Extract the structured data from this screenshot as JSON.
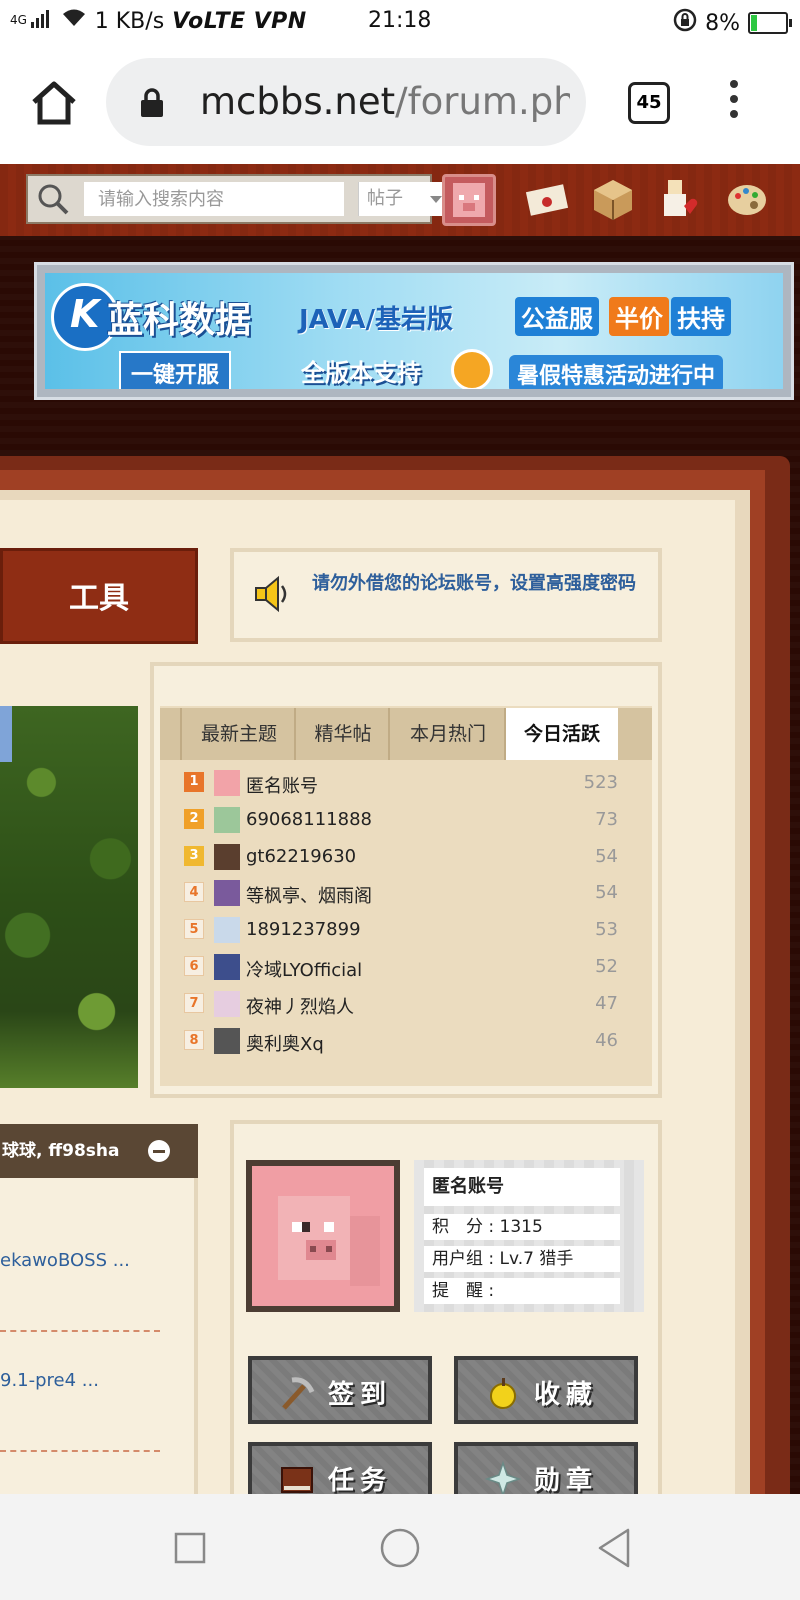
{
  "status_bar": {
    "network": "4G",
    "speed": "1 KB/s",
    "volte": "VoLTE",
    "vpn": "VPN",
    "time": "21:18",
    "battery": "8%"
  },
  "browser": {
    "url_domain": "mcbbs.net",
    "url_path": "/forum.ph",
    "tab_count": "45"
  },
  "topbar": {
    "search_placeholder": "请输入搜索内容",
    "search_type": "帖子"
  },
  "banner": {
    "brand": "蓝科数据",
    "java_label": "JAVA/基岩版",
    "public_label": "公益服",
    "half_price": "半价",
    "support_label": "扶持",
    "one_click": "一键开服",
    "all_versions": "全版本支持",
    "summer_promo": "暑假特惠活动进行中"
  },
  "tools": {
    "label": "工具"
  },
  "notice": {
    "text": "请勿外借您的论坛账号，设置高强度密码"
  },
  "hot_tabs": [
    "最新主题",
    "精华帖",
    "本月热门",
    "今日活跃"
  ],
  "ranking": [
    {
      "rank": "1",
      "name": "匿名账号",
      "count": "523"
    },
    {
      "rank": "2",
      "name": "69068111888",
      "count": "73"
    },
    {
      "rank": "3",
      "name": "gt62219630",
      "count": "54"
    },
    {
      "rank": "4",
      "name": "等枫亭、烟雨阁",
      "count": "54"
    },
    {
      "rank": "5",
      "name": "1891237899",
      "count": "53"
    },
    {
      "rank": "6",
      "name": "冷域LYOfficial",
      "count": "52"
    },
    {
      "rank": "7",
      "name": "夜神丿烈焰人",
      "count": "47"
    },
    {
      "rank": "8",
      "name": "奥利奥Xq",
      "count": "46"
    }
  ],
  "left_panel": {
    "header": "球球, ff98sha",
    "links": [
      "ekawoBOSS ...",
      "9.1-pre4 ..."
    ]
  },
  "user": {
    "name": "匿名账号",
    "points_label": "积　分",
    "points": "1315",
    "group_label": "用户组",
    "group": "Lv.7 猎手",
    "remind_label": "提　醒"
  },
  "user_buttons": {
    "checkin": "签到",
    "favorites": "收藏",
    "tasks": "任务",
    "medals": "勋章"
  },
  "colors": {
    "topbar": "#8c2a12",
    "parchment": "#f6ecd7",
    "link_blue": "#2e5f9b",
    "rank1": "#e8752a"
  }
}
